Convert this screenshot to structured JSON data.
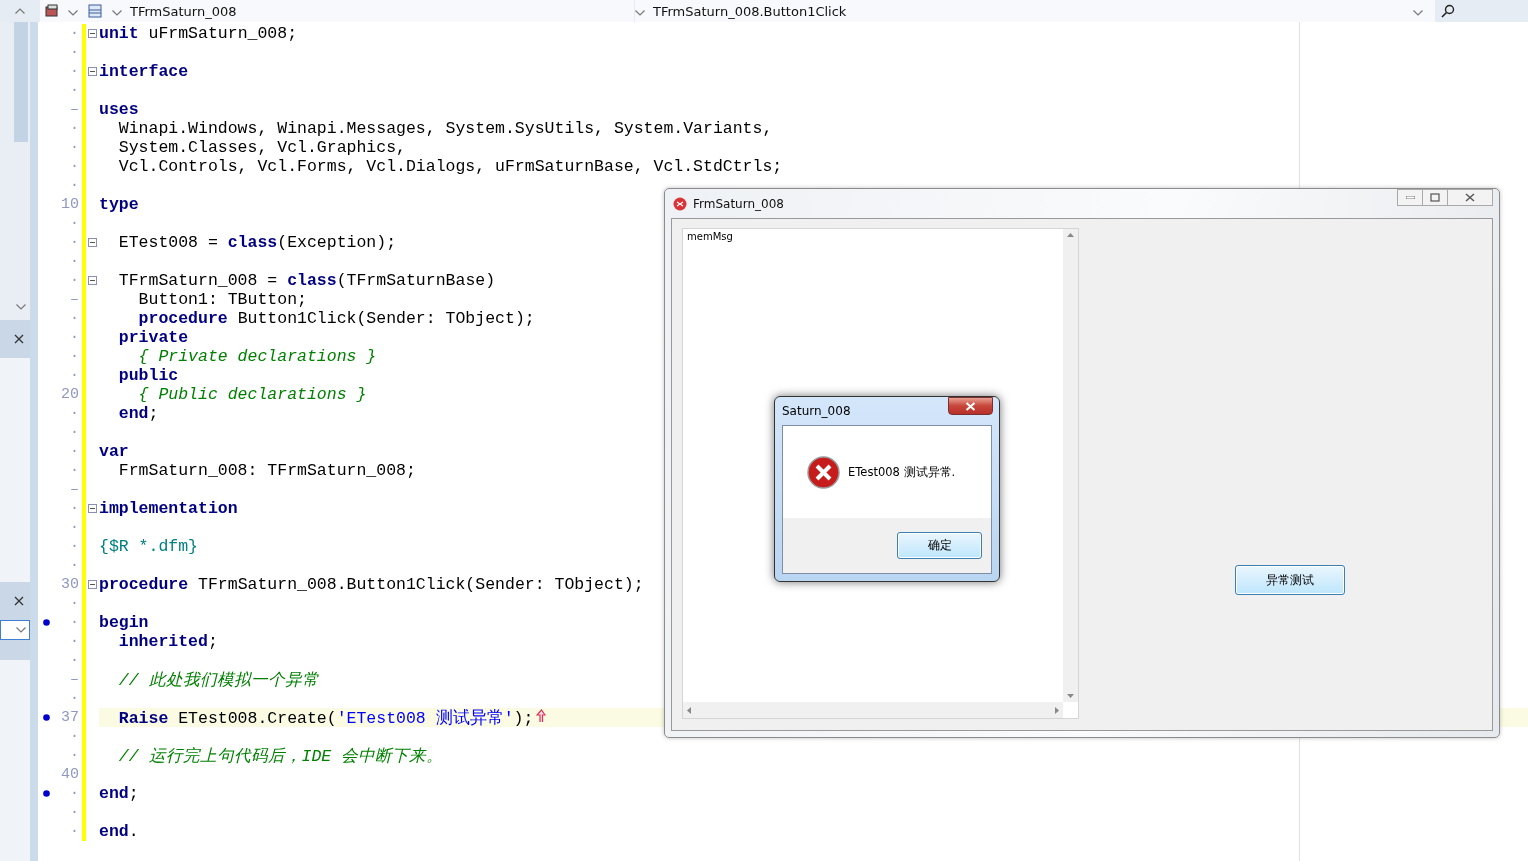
{
  "toolbar": {
    "class_combo": "TFrmSaturn_008",
    "method_combo": "TFrmSaturn_008.Button1Click"
  },
  "editor": {
    "lines": [
      {
        "gutter": "·",
        "marker": false,
        "fold": true,
        "current": false,
        "tokens": [
          {
            "kind": "keyword",
            "text": "unit"
          },
          {
            "kind": "plain",
            "text": " uFrmSaturn_008;"
          }
        ]
      },
      {
        "gutter": "·",
        "marker": false,
        "fold": false,
        "current": false
      },
      {
        "gutter": "·",
        "marker": false,
        "fold": true,
        "current": false,
        "tokens": [
          {
            "kind": "keyword",
            "text": "interface"
          }
        ]
      },
      {
        "gutter": "·",
        "marker": false,
        "fold": false,
        "current": false
      },
      {
        "gutter": "–",
        "marker": false,
        "fold": false,
        "current": false,
        "tokens": [
          {
            "kind": "keyword",
            "text": "uses"
          }
        ]
      },
      {
        "gutter": "·",
        "marker": false,
        "fold": false,
        "current": false,
        "tokens": [
          {
            "kind": "plain",
            "text": "  Winapi.Windows, Winapi.Messages, System.SysUtils, System.Variants,"
          }
        ]
      },
      {
        "gutter": "·",
        "marker": false,
        "fold": false,
        "current": false,
        "tokens": [
          {
            "kind": "plain",
            "text": "  System.Classes, Vcl.Graphics,"
          }
        ]
      },
      {
        "gutter": "·",
        "marker": false,
        "fold": false,
        "current": false,
        "tokens": [
          {
            "kind": "plain",
            "text": "  Vcl.Controls, Vcl.Forms, Vcl.Dialogs, uFrmSaturnBase, Vcl.StdCtrls;"
          }
        ]
      },
      {
        "gutter": "·",
        "marker": false,
        "fold": false,
        "current": false
      },
      {
        "gutter": "10",
        "marker": false,
        "fold": false,
        "current": false,
        "tokens": [
          {
            "kind": "keyword",
            "text": "type"
          }
        ]
      },
      {
        "gutter": "·",
        "marker": false,
        "fold": false,
        "current": false
      },
      {
        "gutter": "·",
        "marker": false,
        "fold": true,
        "current": false,
        "tokens": [
          {
            "kind": "plain",
            "text": "  ETest008 = "
          },
          {
            "kind": "keyword",
            "text": "class"
          },
          {
            "kind": "plain",
            "text": "(Exception);"
          }
        ]
      },
      {
        "gutter": "·",
        "marker": false,
        "fold": false,
        "current": false
      },
      {
        "gutter": "·",
        "marker": false,
        "fold": true,
        "current": false,
        "tokens": [
          {
            "kind": "plain",
            "text": "  TFrmSaturn_008 = "
          },
          {
            "kind": "keyword",
            "text": "class"
          },
          {
            "kind": "plain",
            "text": "(TFrmSaturnBase)"
          }
        ]
      },
      {
        "gutter": "–",
        "marker": false,
        "fold": false,
        "current": false,
        "tokens": [
          {
            "kind": "plain",
            "text": "    Button1: TButton;"
          }
        ]
      },
      {
        "gutter": "·",
        "marker": false,
        "fold": false,
        "current": false,
        "tokens": [
          {
            "kind": "keyword",
            "text": "    procedure"
          },
          {
            "kind": "plain",
            "text": " Button1Click(Sender: TObject);"
          }
        ]
      },
      {
        "gutter": "·",
        "marker": false,
        "fold": false,
        "current": false,
        "tokens": [
          {
            "kind": "keyword",
            "text": "  private"
          }
        ]
      },
      {
        "gutter": "·",
        "marker": false,
        "fold": false,
        "current": false,
        "tokens": [
          {
            "kind": "comment",
            "text": "    { Private declarations }"
          }
        ]
      },
      {
        "gutter": "·",
        "marker": false,
        "fold": false,
        "current": false,
        "tokens": [
          {
            "kind": "keyword",
            "text": "  public"
          }
        ]
      },
      {
        "gutter": "20",
        "marker": false,
        "fold": false,
        "current": false,
        "tokens": [
          {
            "kind": "comment",
            "text": "    { Public declarations }"
          }
        ]
      },
      {
        "gutter": "·",
        "marker": false,
        "fold": false,
        "current": false,
        "tokens": [
          {
            "kind": "keyword",
            "text": "  end"
          },
          {
            "kind": "plain",
            "text": ";"
          }
        ]
      },
      {
        "gutter": "·",
        "marker": false,
        "fold": false,
        "current": false
      },
      {
        "gutter": "·",
        "marker": false,
        "fold": false,
        "current": false,
        "tokens": [
          {
            "kind": "keyword",
            "text": "var"
          }
        ]
      },
      {
        "gutter": "·",
        "marker": false,
        "fold": false,
        "current": false,
        "tokens": [
          {
            "kind": "plain",
            "text": "  FrmSaturn_008: TFrmSaturn_008;"
          }
        ]
      },
      {
        "gutter": "–",
        "marker": false,
        "fold": false,
        "current": false
      },
      {
        "gutter": "·",
        "marker": false,
        "fold": true,
        "current": false,
        "tokens": [
          {
            "kind": "keyword",
            "text": "implementation"
          }
        ]
      },
      {
        "gutter": "·",
        "marker": false,
        "fold": false,
        "current": false
      },
      {
        "gutter": "·",
        "marker": false,
        "fold": false,
        "current": false,
        "tokens": [
          {
            "kind": "directive",
            "text": "{$R *.dfm}"
          }
        ]
      },
      {
        "gutter": "·",
        "marker": false,
        "fold": false,
        "current": false
      },
      {
        "gutter": "30",
        "marker": false,
        "fold": true,
        "current": false,
        "tokens": [
          {
            "kind": "keyword",
            "text": "procedure"
          },
          {
            "kind": "plain",
            "text": " TFrmSaturn_008.Button1Click(Sender: TObject);"
          }
        ]
      },
      {
        "gutter": "·",
        "marker": false,
        "fold": false,
        "current": false
      },
      {
        "gutter": "·",
        "marker": true,
        "fold": false,
        "current": false,
        "tokens": [
          {
            "kind": "keyword",
            "text": "begin"
          }
        ]
      },
      {
        "gutter": "·",
        "marker": false,
        "fold": false,
        "current": false,
        "tokens": [
          {
            "kind": "keyword",
            "text": "  inherited"
          },
          {
            "kind": "plain",
            "text": ";"
          }
        ]
      },
      {
        "gutter": "·",
        "marker": false,
        "fold": false,
        "current": false
      },
      {
        "gutter": "–",
        "marker": false,
        "fold": false,
        "current": false,
        "tokens": [
          {
            "kind": "comment",
            "text": "  // 此处我们模拟一个异常"
          }
        ]
      },
      {
        "gutter": "·",
        "marker": false,
        "fold": false,
        "current": false
      },
      {
        "gutter": "37",
        "marker": true,
        "fold": false,
        "current": true,
        "tokens": [
          {
            "kind": "keyword",
            "text": "  Raise"
          },
          {
            "kind": "plain",
            "text": " ETest008.Create("
          },
          {
            "kind": "string",
            "text": "'ETest008 测试异常'"
          },
          {
            "kind": "plain",
            "text": ");"
          }
        ]
      },
      {
        "gutter": "·",
        "marker": false,
        "fold": false,
        "current": false
      },
      {
        "gutter": "·",
        "marker": false,
        "fold": false,
        "current": false,
        "tokens": [
          {
            "kind": "comment",
            "text": "  // 运行完上句代码后，IDE 会中断下来。"
          }
        ]
      },
      {
        "gutter": "40",
        "marker": false,
        "fold": false,
        "current": false
      },
      {
        "gutter": "·",
        "marker": true,
        "fold": false,
        "current": false,
        "tokens": [
          {
            "kind": "keyword",
            "text": "end"
          },
          {
            "kind": "plain",
            "text": ";"
          }
        ]
      },
      {
        "gutter": "·",
        "marker": false,
        "fold": false,
        "current": false
      },
      {
        "gutter": "·",
        "marker": false,
        "fold": false,
        "current": false,
        "tokens": [
          {
            "kind": "keyword",
            "text": "end"
          },
          {
            "kind": "plain",
            "text": "."
          }
        ]
      }
    ]
  },
  "form_window": {
    "title": "FrmSaturn_008",
    "memo_text": "memMsg",
    "button": "异常测试"
  },
  "dialog": {
    "title": "Saturn_008",
    "message": "ETest008 测试异常.",
    "ok_button": "确定"
  }
}
